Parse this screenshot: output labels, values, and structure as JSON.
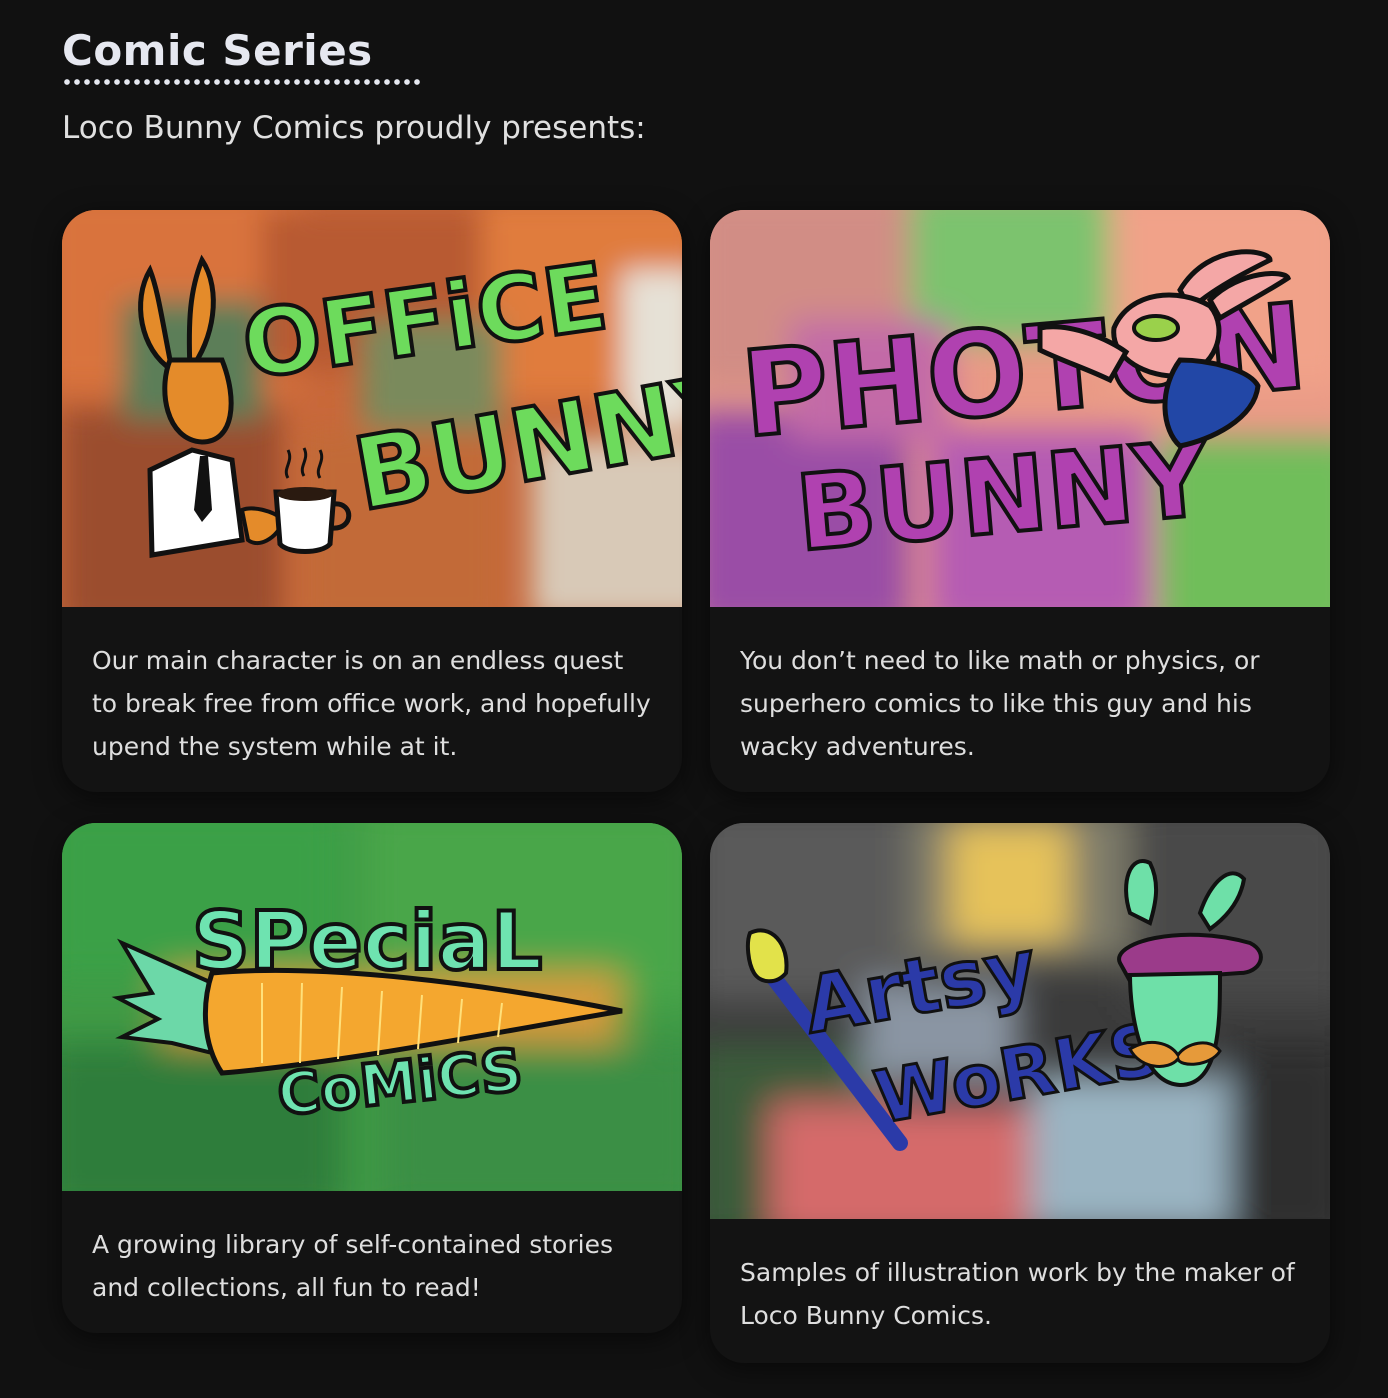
{
  "section": {
    "title": "Comic Series",
    "intro": "Loco Bunny Comics proudly presents:"
  },
  "cards": [
    {
      "logo_text": "Office Bunny",
      "description": "Our main character is on an endless quest to break free from office work, and hopefully upend the system while at it."
    },
    {
      "logo_text": "Photon Bunny",
      "description": "You don’t need to like math or physics, or superhero comics to like this guy and his wacky adventures."
    },
    {
      "logo_text": "Special Comics",
      "description": "A growing library of self-contained stories and collections, all fun to read!"
    },
    {
      "logo_text": "Artsy Works",
      "description": "Samples of illustration work by the maker of Loco Bunny Comics."
    }
  ],
  "colors": {
    "background": "#111111",
    "card": "#131313",
    "title": "#e6e8f0",
    "text": "#dedede"
  }
}
